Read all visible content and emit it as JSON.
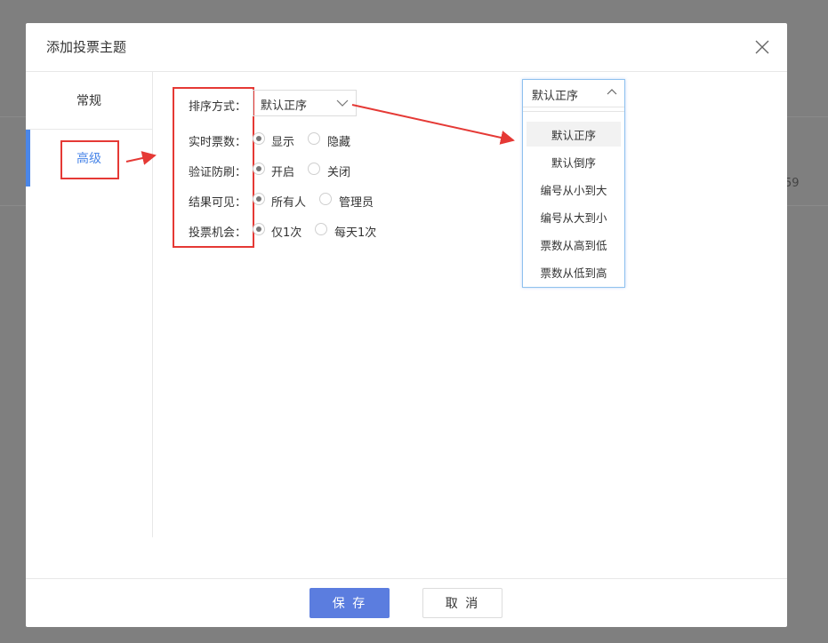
{
  "background": {
    "fragment": "59"
  },
  "modal": {
    "title": "添加投票主题",
    "tabs": [
      {
        "label": "常规",
        "active": false
      },
      {
        "label": "高级",
        "active": true
      }
    ],
    "form": {
      "sort": {
        "label": "排序方式：",
        "value": "默认正序"
      },
      "realtime": {
        "label": "实时票数：",
        "options": [
          "显示",
          "隐藏"
        ],
        "selected": "显示"
      },
      "antispam": {
        "label": "验证防刷：",
        "options": [
          "开启",
          "关闭"
        ],
        "selected": "开启"
      },
      "visibility": {
        "label": "结果可见：",
        "options": [
          "所有人",
          "管理员"
        ],
        "selected": "所有人"
      },
      "chance": {
        "label": "投票机会：",
        "options": [
          "仅1次",
          "每天1次"
        ],
        "selected": "仅1次"
      }
    },
    "dropdown": {
      "value": "默认正序",
      "options": [
        "默认正序",
        "默认倒序",
        "编号从小到大",
        "编号从大到小",
        "票数从高到低",
        "票数从低到高"
      ],
      "selected": "默认正序"
    },
    "footer": {
      "save": "保 存",
      "cancel": "取 消"
    },
    "colors": {
      "accent": "#4a86e8",
      "annotation": "#e53935",
      "primary_button": "#5b7ddf"
    }
  }
}
